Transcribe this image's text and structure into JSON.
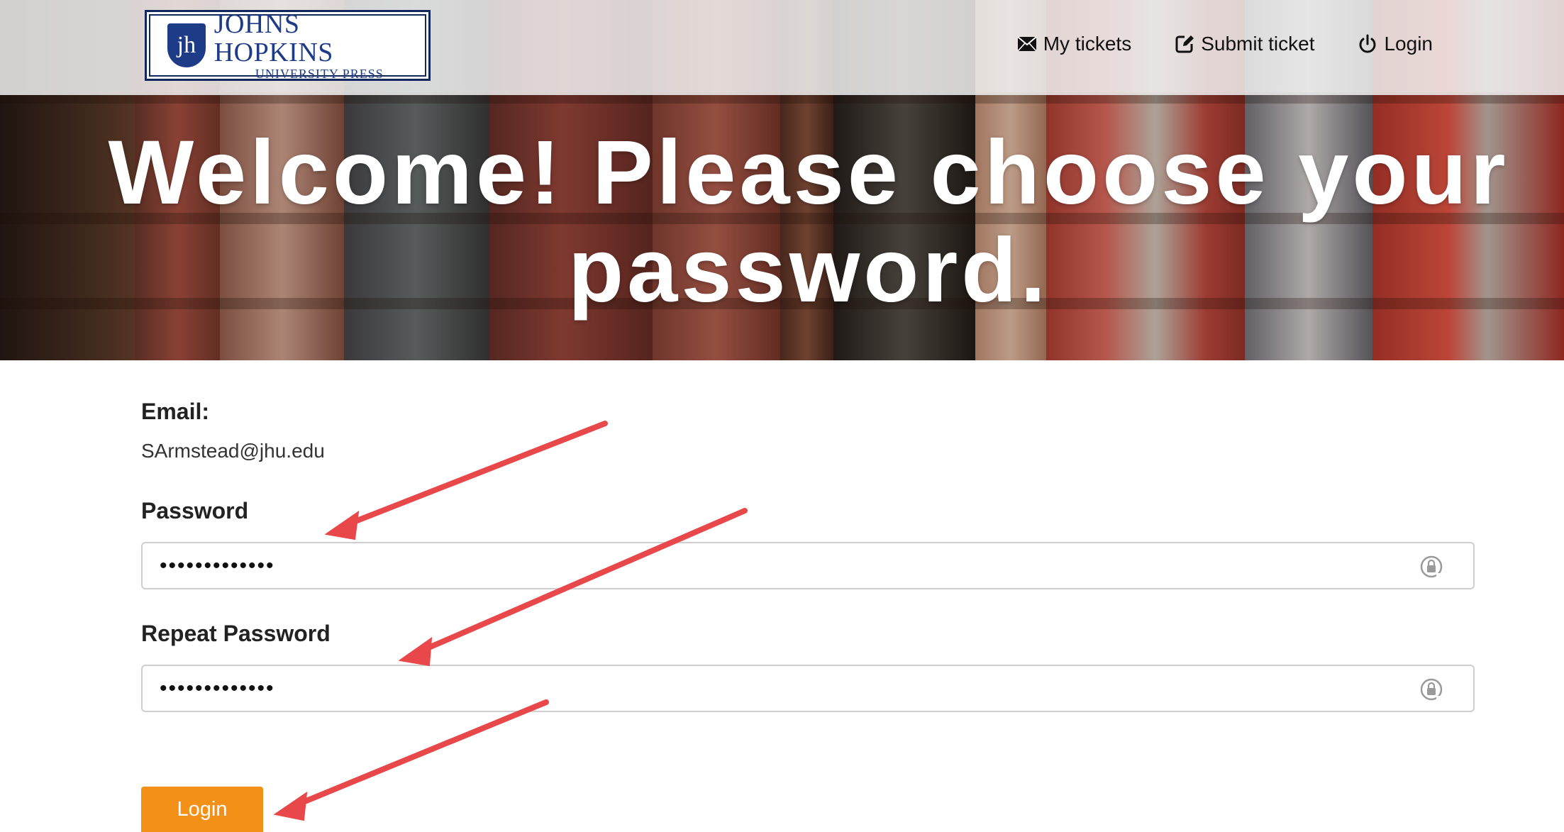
{
  "header": {
    "logo": {
      "monogram": "jh",
      "title": "JOHNS HOPKINS",
      "subtitle": "UNIVERSITY PRESS"
    },
    "nav": [
      {
        "label": "My tickets",
        "icon": "envelope-icon"
      },
      {
        "label": "Submit ticket",
        "icon": "edit-icon"
      },
      {
        "label": "Login",
        "icon": "power-icon"
      }
    ]
  },
  "hero": {
    "title": "Welcome! Please choose your password."
  },
  "form": {
    "email_label": "Email:",
    "email_value": "SArmstead@jhu.edu",
    "password_label": "Password",
    "password_value": "•••••••••••••",
    "repeat_label": "Repeat Password",
    "repeat_value": "•••••••••••••",
    "submit_label": "Login"
  },
  "colors": {
    "accent_button": "#f39018",
    "logo_blue": "#1d3b86",
    "annotation_arrow": "#e8484a"
  }
}
